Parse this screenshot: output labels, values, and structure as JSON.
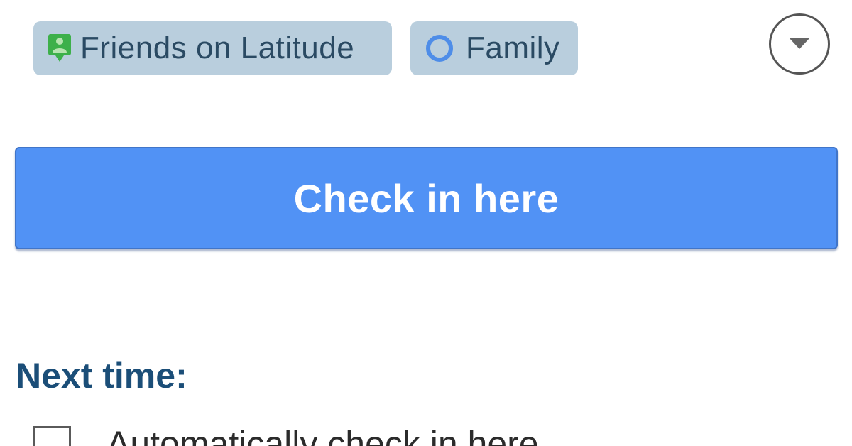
{
  "share_with": {
    "chips": [
      {
        "label": "Friends on Latitude",
        "icon": "latitude-person-icon",
        "icon_color": "#3db04a"
      },
      {
        "label": "Family",
        "icon": "circle-group-icon",
        "icon_color": "#4e8de8"
      }
    ],
    "dropdown_icon": "chevron-down-circle-icon"
  },
  "checkin_button": {
    "label": "Check in here",
    "color": "#5192f5"
  },
  "next_time": {
    "title": "Next time:",
    "options": [
      {
        "label": "Automatically check in here",
        "checked": false
      }
    ]
  }
}
